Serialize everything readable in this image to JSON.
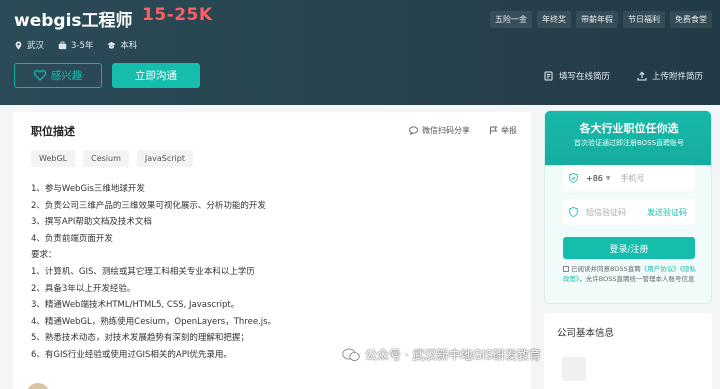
{
  "job": {
    "title": "webgis工程师",
    "salary": "15-25K",
    "location": "武汉",
    "experience": "3-5年",
    "education": "本科",
    "benefits": [
      "五险一金",
      "年终奖",
      "带薪年假",
      "节日福利",
      "免费食堂"
    ]
  },
  "actions": {
    "interest_label": "感兴趣",
    "chat_label": "立即沟通",
    "fill_resume_label": "填写在线简历",
    "upload_resume_label": "上传附件简历"
  },
  "description": {
    "title": "职位描述",
    "share_label": "微信扫码分享",
    "report_label": "举报",
    "tags": [
      "WebGL",
      "Cesium",
      "JavaScript"
    ],
    "lines": [
      "1、参与WebGis三维地球开发",
      "2、负责公司三维产品的三维效果可视化展示、分析功能的开发",
      "3、撰写API帮助文档及技术文档",
      "4、负责前端页面开发",
      "要求：",
      "1、计算机、GIS、测绘或其它理工科相关专业本科以上学历",
      "2、具备3年以上开发经验。",
      "3、精通Web端技术HTML/HTML5, CSS, Javascript。",
      "4、精通WebGL，熟练使用Cesium，OpenLayers，Three.js。",
      "5、熟悉技术动态，对技术发展趋势有深刻的理解和把握；",
      "6、有GIS行业经验或使用过GIS相关的API优先录用。"
    ]
  },
  "login": {
    "headline": "各大行业职位任你选",
    "subtitle": "首次验证通过即注册BOSS直聘账号",
    "country_code": "+86",
    "phone_placeholder": "手机号",
    "code_placeholder": "短信验证码",
    "send_code_label": "发送验证码",
    "submit_label": "登录/注册",
    "agreement_prefix": "已阅读并同意BOSS直聘",
    "user_agreement": "《用户协议》",
    "privacy_policy": "《隐私政策》",
    "agreement_suffix": "，允许BOSS直聘统一管理本人账号信息"
  },
  "company": {
    "title": "公司基本信息"
  },
  "watermark": {
    "text": "公众号 · 武汉新中地GIS研发教育"
  },
  "colors": {
    "accent": "#15bdad",
    "salary": "#ff5e62",
    "header_bg": "#2b4a57"
  }
}
